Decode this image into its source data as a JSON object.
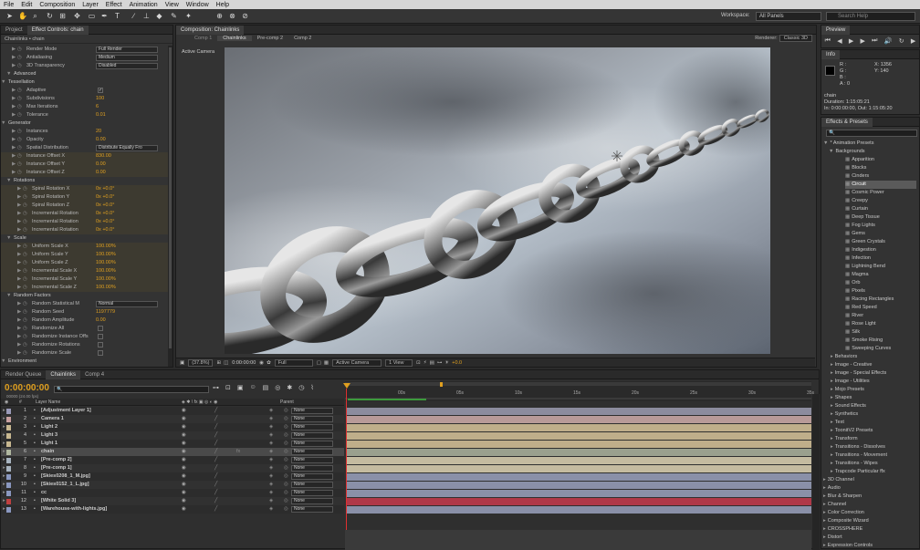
{
  "menu": [
    "File",
    "Edit",
    "Composition",
    "Layer",
    "Effect",
    "Animation",
    "View",
    "Window",
    "Help"
  ],
  "toolbar": {
    "workspace_label": "Workspace:",
    "workspace_value": "All Panels",
    "search_help": "Search Help"
  },
  "left_panel": {
    "tabs": [
      "Project",
      "Effect Controls: chain"
    ],
    "breadcrumb": "Chainlinks • chain",
    "rows": [
      {
        "name": "Render Mode",
        "sel": "Full Render",
        "indent": 3,
        "type": "sel"
      },
      {
        "name": "Antialiasing",
        "sel": "Medium",
        "indent": 3,
        "type": "sel"
      },
      {
        "name": "3D Transparency",
        "sel": "Disabled",
        "indent": 3,
        "type": "sel"
      },
      {
        "name": "Advanced",
        "indent": 2,
        "type": "grp"
      },
      {
        "name": "Tessellation",
        "indent": 1,
        "type": "grp"
      },
      {
        "name": "Adaptive",
        "chk": "✓",
        "indent": 3,
        "type": "chk"
      },
      {
        "name": "Subdivisions",
        "val": "100",
        "indent": 3,
        "type": "val"
      },
      {
        "name": "Max Iterations",
        "val": "6",
        "indent": 3,
        "type": "val"
      },
      {
        "name": "Tolerance",
        "val": "0.01",
        "indent": 3,
        "type": "val"
      },
      {
        "name": "Generator",
        "indent": 1,
        "type": "grp"
      },
      {
        "name": "Instances",
        "val": "20",
        "indent": 3,
        "type": "val"
      },
      {
        "name": "Opacity",
        "val": "0.00",
        "indent": 3,
        "type": "val"
      },
      {
        "name": "Spatial Distribution",
        "sel": "Distribute Equally Fro",
        "indent": 3,
        "type": "sel"
      },
      {
        "name": "Instance Offset X",
        "val": "830.00",
        "indent": 3,
        "type": "val",
        "hl": true
      },
      {
        "name": "Instance Offset Y",
        "val": "0.00",
        "indent": 3,
        "type": "val",
        "hl": true
      },
      {
        "name": "Instance Offset Z",
        "val": "0.00",
        "indent": 3,
        "type": "val",
        "hl": true
      },
      {
        "name": "Rotations",
        "indent": 2,
        "type": "grp"
      },
      {
        "name": "Spiral Rotation X",
        "val": "0x +0.0°",
        "indent": 4,
        "type": "val",
        "hl": true
      },
      {
        "name": "Spiral Rotation Y",
        "val": "0x +0.0°",
        "indent": 4,
        "type": "val",
        "hl": true
      },
      {
        "name": "Spiral Rotation Z",
        "val": "0x +0.0°",
        "indent": 4,
        "type": "val",
        "hl": true
      },
      {
        "name": "Incremental Rotation",
        "val": "0x +0.0°",
        "indent": 4,
        "type": "val",
        "hl": true
      },
      {
        "name": "Incremental Rotation",
        "val": "0x +0.0°",
        "indent": 4,
        "type": "val",
        "hl": true
      },
      {
        "name": "Incremental Rotation",
        "val": "0x +0.0°",
        "indent": 4,
        "type": "val",
        "hl": true
      },
      {
        "name": "Scale",
        "indent": 2,
        "type": "grp"
      },
      {
        "name": "Uniform Scale X",
        "val": "100.00%",
        "indent": 4,
        "type": "val",
        "hl": true
      },
      {
        "name": "Uniform Scale Y",
        "val": "100.00%",
        "indent": 4,
        "type": "val",
        "hl": true
      },
      {
        "name": "Uniform Scale Z",
        "val": "100.00%",
        "indent": 4,
        "type": "val",
        "hl": true
      },
      {
        "name": "Incremental Scale X",
        "val": "100.00%",
        "indent": 4,
        "type": "val",
        "hl": true
      },
      {
        "name": "Incremental Scale Y",
        "val": "100.00%",
        "indent": 4,
        "type": "val",
        "hl": true
      },
      {
        "name": "Incremental Scale Z",
        "val": "100.00%",
        "indent": 4,
        "type": "val",
        "hl": true
      },
      {
        "name": "Random Factors",
        "indent": 2,
        "type": "grp"
      },
      {
        "name": "Random Statistical M",
        "sel": "Normal",
        "indent": 4,
        "type": "sel"
      },
      {
        "name": "Random Seed",
        "val": "1197779",
        "indent": 4,
        "type": "val"
      },
      {
        "name": "Random Amplitude",
        "val": "0.00",
        "indent": 4,
        "type": "val"
      },
      {
        "name": "Randomize All",
        "chk": "",
        "indent": 4,
        "type": "chk"
      },
      {
        "name": "Randomize Instance Offs",
        "chk": "",
        "indent": 4,
        "type": "chk"
      },
      {
        "name": "Randomize Rotations",
        "chk": "",
        "indent": 4,
        "type": "chk"
      },
      {
        "name": "Randomize Scale",
        "chk": "",
        "indent": 4,
        "type": "chk"
      },
      {
        "name": "Environment",
        "indent": 1,
        "type": "grp"
      }
    ]
  },
  "viewer": {
    "tab": "Composition: Chainlinks",
    "comp_tabs": [
      "Comp 1",
      "Chainlinks",
      "Pre-comp 2",
      "Comp 2"
    ],
    "renderer_label": "Renderer:",
    "renderer_value": "Classic 3D",
    "camera": "Active Camera",
    "footer": {
      "zoom": "(37.8%)",
      "time": "0:00:00:00",
      "res": "Full",
      "view": "Active Camera",
      "views": "1 View",
      "exposure": "+0.0"
    }
  },
  "right_panel": {
    "preview_tab": "Preview",
    "info_tab": "Info",
    "info": {
      "r": "R :",
      "g": "G :",
      "b": "B :",
      "a": "A : 0",
      "x": "X: 1356",
      "y": "Y: 140",
      "layer": "chain",
      "duration": "Duration: 1:15:05:21",
      "inout": "In: 0:00:00:00, Out: 1:15:05:20"
    },
    "effects_tab": "Effects & Presets",
    "tree_root": "* Animation Presets",
    "tree_bg": "Backgrounds",
    "backgrounds": [
      "Apparition",
      "Blocks",
      "Cinders",
      "Circuit",
      "Cosmic Power",
      "Creepy",
      "Curtain",
      "Deep Tissue",
      "Fog Lights",
      "Gems",
      "Green Crystals",
      "Indigestion",
      "Infection",
      "Lightning Bend",
      "Magma",
      "Orb",
      "Pixels",
      "Racing Rectangles",
      "Red Speed",
      "River",
      "Rose Light",
      "Silk",
      "Smoke Rising",
      "Sweeping Curves"
    ],
    "folders": [
      "Behaviors",
      "Image - Creative",
      "Image - Special Effects",
      "Image - Utilities",
      "Mojo Presets",
      "Shapes",
      "Sound Effects",
      "Synthetics",
      "Text",
      "ToonitV2 Presets",
      "Transform",
      "Transitions - Dissolves",
      "Transitions - Movement",
      "Transitions - Wipes",
      "Trapcode Particular ffx"
    ],
    "categories": [
      "3D Channel",
      "Audio",
      "Blur & Sharpen",
      "Channel",
      "Color Correction",
      "Composite Wizard",
      "CROSSPHERE",
      "Distort",
      "Expression Controls"
    ]
  },
  "timeline": {
    "tabs": [
      "Render Queue",
      "Chainlinks",
      "Comp 4"
    ],
    "timecode": "0:00:00:00",
    "timecode_sub": "00000 (24.00 fps)",
    "col_layer": "Layer Name",
    "col_parent": "Parent",
    "ruler": [
      "00s",
      "05s",
      "10s",
      "15s",
      "20s",
      "25s",
      "30s",
      "35s"
    ],
    "layers": [
      {
        "num": "1",
        "name": "[Adjustment Layer 1]",
        "color": "#9a9ab8",
        "bar": "#8c8c9e",
        "parent": "None"
      },
      {
        "num": "2",
        "name": "Camera 1",
        "color": "#c8a0a0",
        "bar": "#b89a98",
        "parent": "None"
      },
      {
        "num": "3",
        "name": "Light 2",
        "color": "#c8b890",
        "bar": "#bfae8a",
        "parent": "None"
      },
      {
        "num": "4",
        "name": "Light 3",
        "color": "#c8b890",
        "bar": "#bfae8a",
        "parent": "None"
      },
      {
        "num": "5",
        "name": "Light 1",
        "color": "#c8b890",
        "bar": "#bfae8a",
        "parent": "None"
      },
      {
        "num": "6",
        "name": "chain",
        "color": "#b0b8a0",
        "bar": "#9aa08e",
        "parent": "None",
        "sel": true
      },
      {
        "num": "7",
        "name": "[Pre-comp 2]",
        "color": "#a8b4c0",
        "bar": "#c4bba0",
        "parent": "None"
      },
      {
        "num": "8",
        "name": "[Pre-comp 1]",
        "color": "#a8b4c0",
        "bar": "#c4bba0",
        "parent": "None"
      },
      {
        "num": "9",
        "name": "[Skies0208_1_M.jpg]",
        "color": "#8a98c0",
        "bar": "#8a90a8",
        "parent": "None"
      },
      {
        "num": "10",
        "name": "[Skies0152_1_L.jpg]",
        "color": "#8a98c0",
        "bar": "#8a90a8",
        "parent": "None"
      },
      {
        "num": "11",
        "name": "cc",
        "color": "#8a98c0",
        "bar": "#8a90a8",
        "parent": "None"
      },
      {
        "num": "12",
        "name": "[White Solid 3]",
        "color": "#c04040",
        "bar": "#b03848",
        "parent": "None"
      },
      {
        "num": "13",
        "name": "[Warehouse-with-lights.jpg]",
        "color": "#8a98c0",
        "bar": "#8a90a8",
        "parent": "None"
      }
    ]
  }
}
